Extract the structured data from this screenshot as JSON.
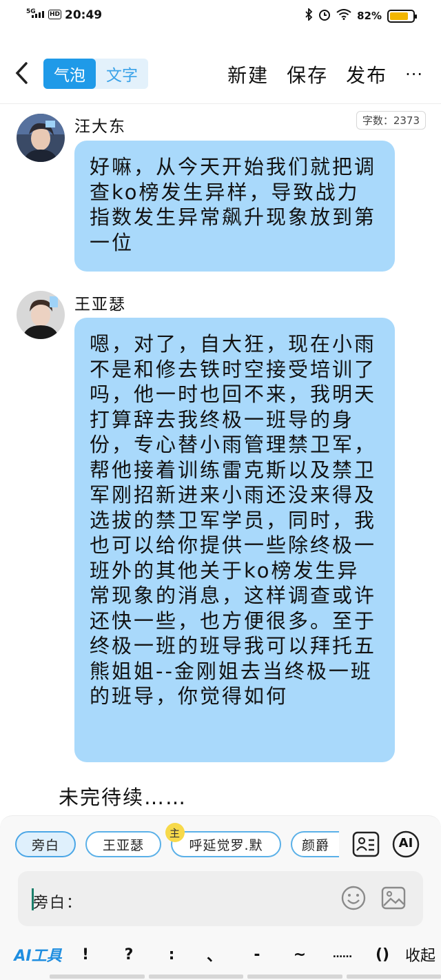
{
  "status": {
    "network": "5G",
    "hd": "HD",
    "time": "20:49",
    "battery": "82%",
    "battery_level": 0.82
  },
  "header": {
    "tab_active": "气泡",
    "tab_inactive": "文字",
    "new": "新建",
    "save": "保存",
    "publish": "发布",
    "more": "···"
  },
  "word_count": "字数：2373",
  "messages": [
    {
      "name": "汪大东",
      "text": "好嘛，从今天开始我们就把调查ko榜发生异样，导致战力指数发生异常飙升现象放到第一位",
      "avatar_text": "汪大东"
    },
    {
      "name": "王亚瑟",
      "text": "嗯，对了，自大狂，现在小雨不是和修去铁时空接受培训了吗，他一时也回不来，我明天打算辞去我终极一班导的身份，专心替小雨管理禁卫军，帮他接着训练雷克斯以及禁卫军刚招新进来小雨还没来得及选拔的禁卫军学员，同时，我也可以给你提供一些除终极一班外的其他关于ko榜发生异常现象的消息，这样调查或许还快一些，也方便很多。至于终极一班的班导我可以拜托五熊姐姐--金刚姐去当终极一班的班导，你觉得如何",
      "avatar_text": "王亚瑟"
    }
  ],
  "pending": "未完待续……",
  "roles": [
    {
      "label": "旁白"
    },
    {
      "label": "王亚瑟"
    },
    {
      "label": "呼延觉罗.默",
      "badge": "主"
    },
    {
      "label": "颜爵"
    }
  ],
  "input": {
    "prefix": "旁白："
  },
  "tools": {
    "ai": "AI工具",
    "items": [
      "!",
      "?",
      ":",
      "、",
      "-",
      "~",
      "……",
      "()"
    ],
    "collapse": "收起"
  },
  "ai_label": "AI",
  "colors": {
    "accent": "#1f9ae8",
    "bubble": "#a9d9fb",
    "battery": "#f2b600"
  }
}
